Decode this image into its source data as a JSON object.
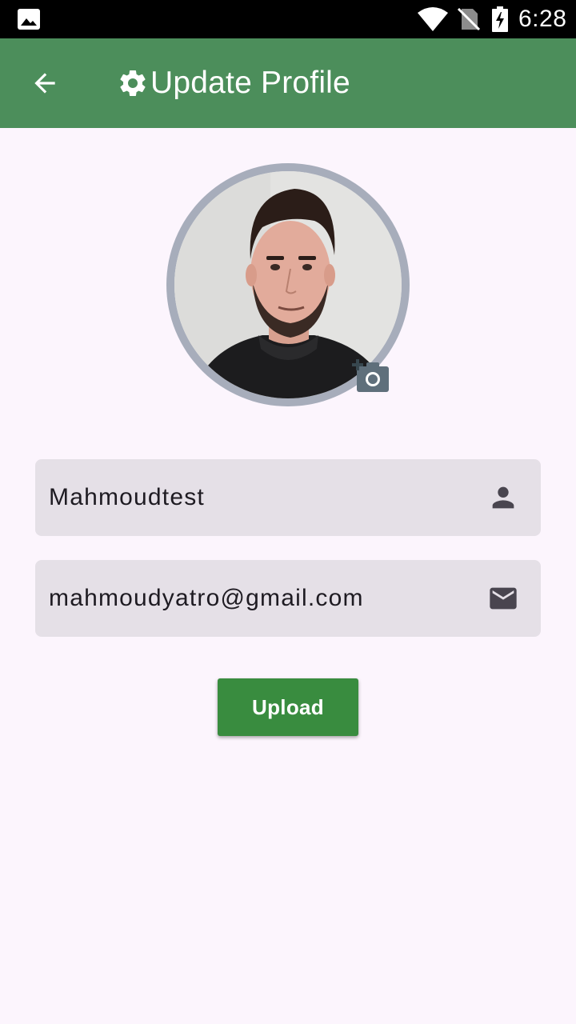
{
  "status_bar": {
    "time": "6:28",
    "icons": [
      "gallery-icon",
      "wifi-icon",
      "no-sim-icon",
      "battery-charging-icon"
    ]
  },
  "app_bar": {
    "title": "Update Profile",
    "back_icon": "arrow-back-icon",
    "title_icon": "gear-icon",
    "background": "#4c8e5b"
  },
  "profile": {
    "avatar_ring_color": "#a7adbb",
    "add_photo_icon": "add-a-photo-icon"
  },
  "form": {
    "name_value": "Mahmoudtest",
    "name_icon": "person-icon",
    "email_value": "mahmoudyatro@gmail.com",
    "email_icon": "mail-icon",
    "field_background": "#e5e0e7"
  },
  "actions": {
    "upload_label": "Upload",
    "upload_color": "#398c3f"
  }
}
